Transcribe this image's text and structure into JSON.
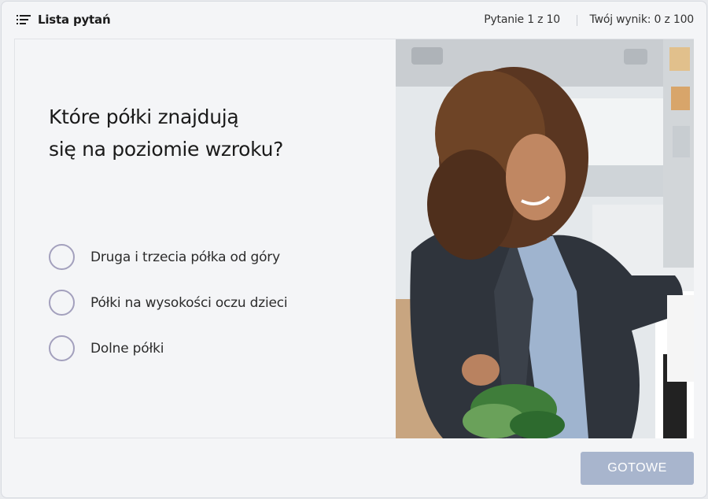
{
  "header": {
    "list_label": "Lista pytań",
    "list_icon": "list-icon",
    "progress_text": "Pytanie 1 z 10",
    "score_text": "Twój wynik: 0 z 100"
  },
  "question": {
    "line1": "Które półki znajdują",
    "line2": "się na poziomie wzroku?"
  },
  "answers": [
    {
      "label": "Druga i trzecia półka od góry"
    },
    {
      "label": "Półki na wysokości oczu dzieci"
    },
    {
      "label": "Dolne półki"
    }
  ],
  "footer": {
    "done_label": "GOTOWE"
  },
  "colors": {
    "accent_radio": "#a3a0bd",
    "done_button": "#a8b5cd"
  }
}
